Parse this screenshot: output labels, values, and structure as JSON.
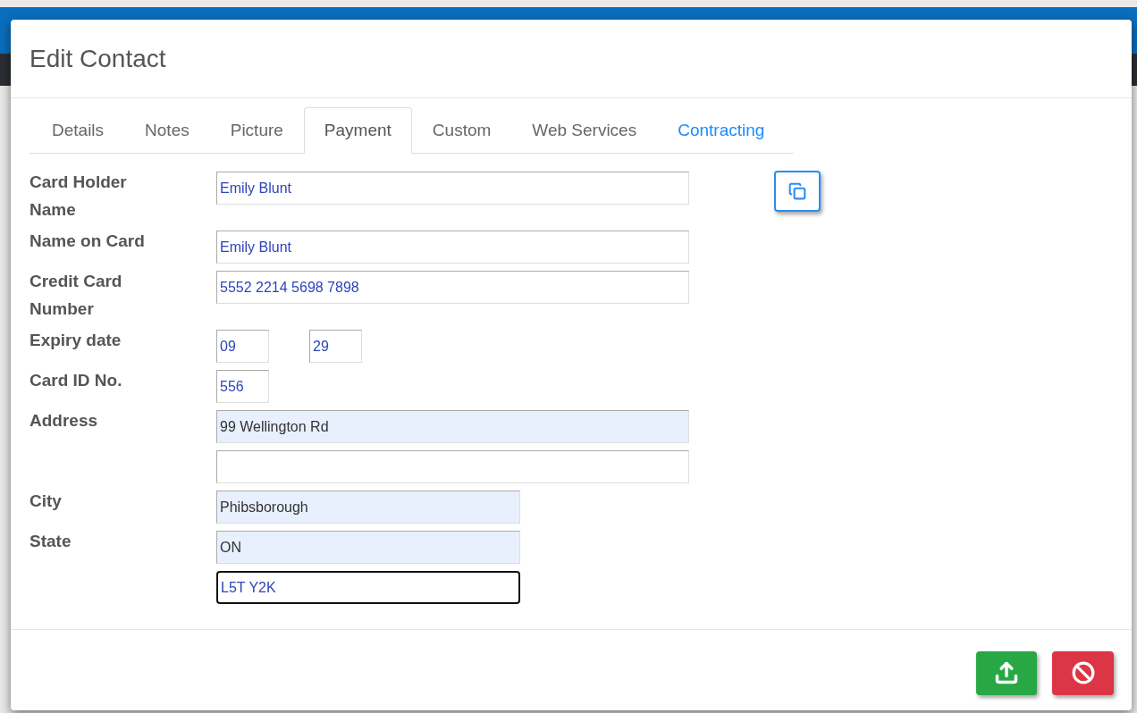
{
  "dialog": {
    "title": "Edit Contact"
  },
  "tabs": [
    {
      "label": "Details",
      "selected": false,
      "highlighted": false
    },
    {
      "label": "Notes",
      "selected": false,
      "highlighted": false
    },
    {
      "label": "Picture",
      "selected": false,
      "highlighted": false
    },
    {
      "label": "Payment",
      "selected": true,
      "highlighted": false
    },
    {
      "label": "Custom",
      "selected": false,
      "highlighted": false
    },
    {
      "label": "Web Services",
      "selected": false,
      "highlighted": false
    },
    {
      "label": "Contracting",
      "selected": false,
      "highlighted": true
    }
  ],
  "rows": [
    {
      "label": "Card Holder Name",
      "copy_button": true,
      "fields": [
        {
          "kind": "wide",
          "value": "Emily Blunt",
          "autofilled": false,
          "focused": false
        }
      ]
    },
    {
      "label": "Name on Card",
      "fields": [
        {
          "kind": "wide",
          "value": "Emily Blunt",
          "autofilled": false,
          "focused": false
        }
      ]
    },
    {
      "label": "Credit Card Number",
      "fields": [
        {
          "kind": "wide",
          "value": "5552 2214 5698 7898",
          "autofilled": false,
          "focused": false
        }
      ]
    },
    {
      "label": "Expiry date",
      "fields": [
        {
          "kind": "short",
          "value": "09",
          "autofilled": false,
          "focused": false
        },
        {
          "kind": "short",
          "value": "29",
          "autofilled": false,
          "focused": false
        }
      ]
    },
    {
      "label": "Card ID No.",
      "fields": [
        {
          "kind": "short",
          "value": "556",
          "autofilled": false,
          "focused": false
        }
      ]
    },
    {
      "label": "Address",
      "fields": [
        {
          "kind": "wide",
          "value": "99 Wellington Rd",
          "autofilled": true,
          "focused": false
        }
      ]
    },
    {
      "fields": [
        {
          "kind": "wide",
          "autofilled": false,
          "focused": false
        }
      ]
    },
    {
      "label": "City",
      "fields": [
        {
          "kind": "medium",
          "value": "Phibsborough",
          "autofilled": true,
          "focused": false
        }
      ]
    },
    {
      "label": "State",
      "fields": [
        {
          "kind": "medium",
          "value": "ON",
          "autofilled": true,
          "focused": false
        }
      ]
    },
    {
      "fields": [
        {
          "kind": "medium",
          "value": "L5T Y2K",
          "autofilled": false,
          "focused": true
        }
      ]
    }
  ],
  "footer_buttons": [
    {
      "kind": "save"
    },
    {
      "kind": "cancel"
    }
  ]
}
